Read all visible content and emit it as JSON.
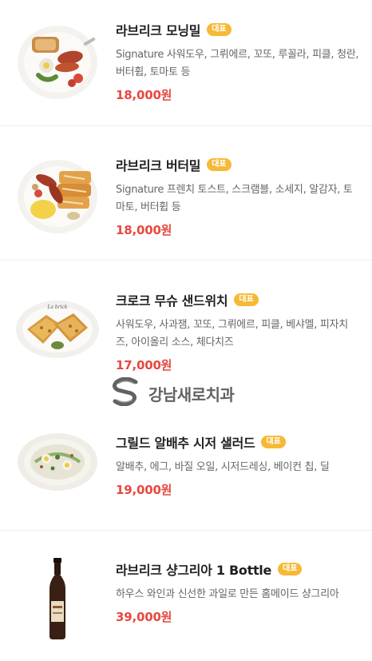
{
  "menu": {
    "items": [
      {
        "name": "라브리크 모닝밀",
        "badge": "대표",
        "description": "Signature 사워도우, 그뤼에르, 꼬또, 루꼴라, 피클, 청란, 버터휩, 토마토 등",
        "price": "18,000원",
        "image_icon": "breakfast-plate-icon"
      },
      {
        "name": "라브리크 버터밀",
        "badge": "대표",
        "description": "Signature 프렌치 토스트, 스크램블, 소세지, 알감자, 토마토, 버터휩 등",
        "price": "18,000원",
        "image_icon": "french-toast-plate-icon"
      },
      {
        "name": "크로크 무슈 샌드위치",
        "badge": "대표",
        "description": "사워도우, 사과잼, 꼬또, 그뤼에르, 피클, 베샤멜, 피자치즈, 아이올리 소스, 체다치즈",
        "price": "17,000원",
        "image_icon": "sandwich-plate-icon"
      },
      {
        "name": "그릴드 알배추 시저 샐러드",
        "badge": "대표",
        "description": "알배추, 에그, 바질 오일, 시저드레싱, 베이컨 칩, 딜",
        "price": "19,000원",
        "image_icon": "salad-bowl-icon"
      },
      {
        "name": "라브리크 샹그리아 1 Bottle",
        "badge": "대표",
        "description": "하우스 와인과 신선한 과일로 만든 홈메이드 샹그리아",
        "price": "39,000원",
        "image_icon": "wine-bottle-icon"
      }
    ]
  },
  "watermark": {
    "text": "강남새로치과",
    "icon": "clinic-logo-icon"
  },
  "colors": {
    "price": "#e8483f",
    "badge": "#f6b935",
    "name": "#1f1f1f",
    "description": "#666666",
    "divider": "#eeeeee"
  }
}
